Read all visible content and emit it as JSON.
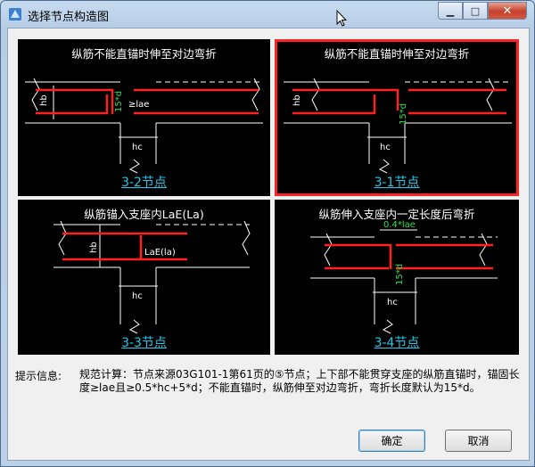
{
  "window": {
    "title": "选择节点构造图"
  },
  "panels": [
    {
      "title": "纵筋不能直锚时伸至对边弯折",
      "label": "3-2节点",
      "selected": false,
      "annotations": {
        "hb": "hb",
        "d15": "15*d",
        "lae": "≥lae",
        "hc": "hc"
      }
    },
    {
      "title": "纵筋不能直锚时伸至对边弯折",
      "label": "3-1节点",
      "selected": true,
      "annotations": {
        "hb": "hb",
        "d15": "15*d",
        "hc": "hc"
      }
    },
    {
      "title": "纵筋锚入支座内LaE(La)",
      "label": "3-3节点",
      "selected": false,
      "annotations": {
        "hb": "hb",
        "lae": "LaE(la)",
        "hc": "hc"
      }
    },
    {
      "title": "纵筋伸入支座内一定长度后弯折",
      "label": "3-4节点",
      "selected": false,
      "annotations": {
        "top": "0.4*lae",
        "d15": "15*d",
        "hc": "hc"
      }
    }
  ],
  "info": {
    "label": "提示信息:",
    "text": "规范计算：节点来源03G101-1第61页的⑤节点；上下部不能贯穿支座的纵筋直锚时，锚固长度≥lae且≥0.5*hc+5*d；不能直锚时，纵筋伸至对边弯折，弯折长度默认为15*d。"
  },
  "buttons": {
    "ok": "确定",
    "cancel": "取消"
  },
  "colors": {
    "rebar": "#ff2020",
    "annotation_green": "#2ee04a",
    "label_cyan": "#21c6e8",
    "selected_border": "#ff2222"
  }
}
